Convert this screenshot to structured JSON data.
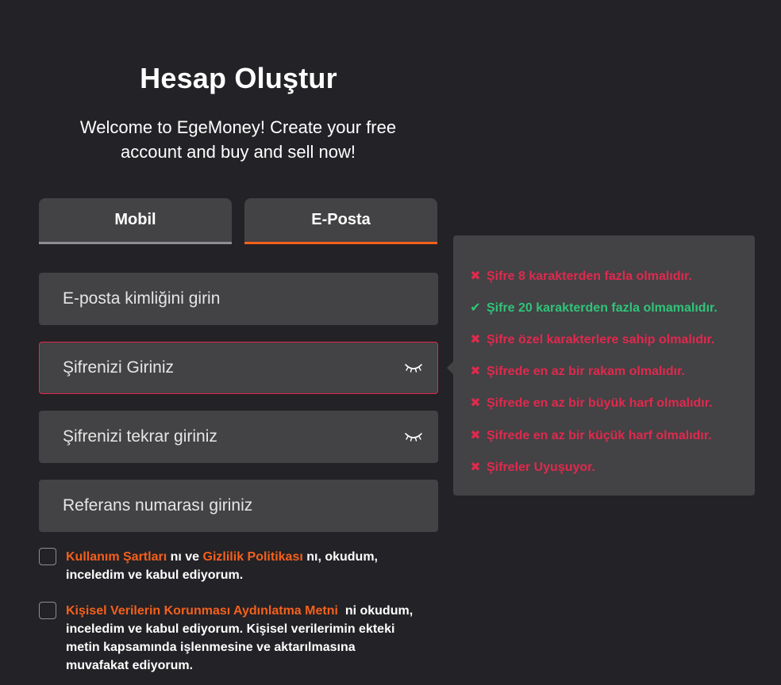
{
  "header": {
    "title": "Hesap Oluştur",
    "subtitle": "Welcome to EgeMoney! Create your free account and buy and sell now!"
  },
  "tabs": [
    {
      "label": "Mobil",
      "active": false
    },
    {
      "label": "E-Posta",
      "active": true
    }
  ],
  "form": {
    "email_placeholder": "E-posta kimliğini girin",
    "password_placeholder": "Şifrenizi Giriniz",
    "password_repeat_placeholder": "Şifrenizi tekrar giriniz",
    "reference_placeholder": "Referans numarası giriniz"
  },
  "consents": {
    "terms": {
      "link1": "Kullanım Şartları",
      "text1": " nı ve ",
      "link2": "Gizlilik Politikası",
      "text2": " nı, okudum, inceledim ve kabul ediyorum."
    },
    "kvkk": {
      "link": "Kişisel Verilerin Korunması Aydınlatma Metni",
      "text": "  ni okudum, inceledim ve kabul ediyorum. Kişisel verilerimin ekteki metin kapsamında işlenmesine ve aktarılmasına muvafakat ediyorum."
    }
  },
  "password_rules": [
    {
      "text": "Şifre 8 karakterden fazla olmalıdır.",
      "status": "fail",
      "mark": "✖"
    },
    {
      "text": "Şifre 20 karakterden fazla olmamalıdır.",
      "status": "pass",
      "mark": "✔"
    },
    {
      "text": "Şifre özel karakterlere sahip olmalıdır.",
      "status": "fail",
      "mark": "✖"
    },
    {
      "text": "Şifrede en az bir rakam olmalıdır.",
      "status": "fail",
      "mark": "✖"
    },
    {
      "text": "Şifrede en az bir büyük harf olmalıdır.",
      "status": "fail",
      "mark": "✖"
    },
    {
      "text": "Şifrede en az bir küçük harf olmalıdır.",
      "status": "fail",
      "mark": "✖"
    },
    {
      "text": "Şifreler Uyuşuyor.",
      "status": "fail",
      "mark": "✖"
    }
  ],
  "colors": {
    "background": "#232226",
    "surface": "#434244",
    "accent": "#f4601c",
    "error": "#e0294e",
    "success": "#2fc47a"
  },
  "icons": {
    "password_toggle": "eye-closed-icon",
    "rule_fail": "cross-icon",
    "rule_pass": "check-icon"
  }
}
